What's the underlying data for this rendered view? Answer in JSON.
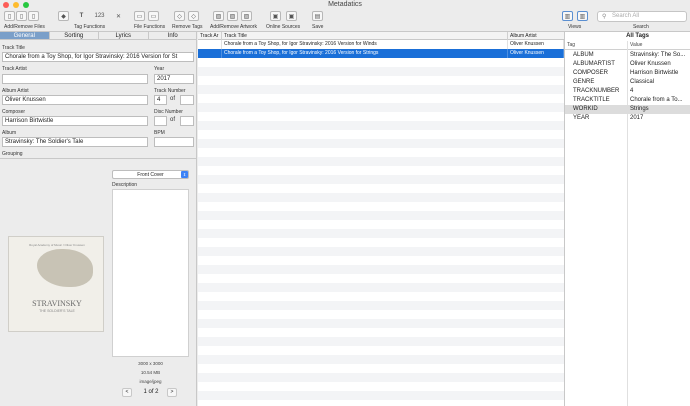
{
  "window": {
    "title": "Metadatics"
  },
  "toolbar": {
    "groups": [
      {
        "label": "Add/Remove Files",
        "icons": [
          "doc-icon",
          "doc-add-icon",
          "doc-remove-icon"
        ]
      },
      {
        "label": "Tag Functions",
        "icons": [
          "tag-icon",
          "text-T-icon",
          "number-123-icon",
          "tools-icon"
        ]
      },
      {
        "label": "File Functions",
        "icons": [
          "file-functions-icon-1",
          "file-functions-icon-2"
        ]
      },
      {
        "label": "Remove Tags",
        "icons": [
          "remove-tags-icon-1",
          "remove-tags-icon-2"
        ]
      },
      {
        "label": "Add/Remove Artwork",
        "icons": [
          "artwork-icon-1",
          "artwork-icon-2",
          "artwork-icon-3"
        ]
      },
      {
        "label": "Online Sources",
        "icons": [
          "online-source-icon-1",
          "online-source-icon-2"
        ]
      },
      {
        "label": "Save",
        "icons": [
          "save-icon"
        ]
      },
      {
        "label": "Views",
        "icons": [
          "view-left-icon",
          "view-right-icon"
        ]
      }
    ],
    "search_label": "Search",
    "search_placeholder": "Search All"
  },
  "left_tabs": [
    "General",
    "Sorting",
    "Lyrics",
    "Info"
  ],
  "fields": {
    "track_title_label": "Track Title",
    "track_title": "Chorale from a Toy Shop, for Igor Stravinsky: 2016 Version for St",
    "track_artist_label": "Track Artist",
    "track_artist": "",
    "year_label": "Year",
    "year": "2017",
    "album_artist_label": "Album Artist",
    "album_artist": "Oliver Knussen",
    "track_number_label": "Track Number",
    "track_number": "4",
    "track_of_label": "of",
    "track_total": "",
    "composer_label": "Composer",
    "composer": "Harrison Birtwistle",
    "disc_number_label": "Disc Number",
    "disc_number": "",
    "disc_of_label": "of",
    "disc_total": "",
    "album_label": "Album",
    "album": "Stravinsky: The Soldier's Tale",
    "bpm_label": "BPM",
    "bpm": "",
    "grouping_label": "Grouping"
  },
  "artwork": {
    "type_select": "Front Cover",
    "description_label": "Description",
    "dimensions": "3000 x 3000",
    "size": "10.54 MB",
    "format": "image/jpeg",
    "page": "1 of 2",
    "prev": "<",
    "next": ">",
    "cover_title": "STRAVINSKY",
    "cover_subtitle": "THE SOLDIER'S TALE",
    "cover_small": "Royal Academy of Music / Oliver Knussen"
  },
  "middle_table": {
    "columns": [
      "Track Ar",
      "Track Title",
      "Album Artist"
    ],
    "rows": [
      {
        "track_artist": "",
        "track_title": "Chorale from a Toy Shop, for Igor Stravinsky: 2016 Version for Winds",
        "album_artist": "Oliver Knussen",
        "selected": false
      },
      {
        "track_artist": "",
        "track_title": "Chorale from a Toy Shop, for Igor Stravinsky: 2016 Version for Strings",
        "album_artist": "Oliver Knussen",
        "selected": true
      }
    ]
  },
  "all_tags": {
    "title": "All Tags",
    "col_tag": "Tag",
    "col_value": "Value",
    "rows": [
      {
        "tag": "ALBUM",
        "value": "Stravinsky: The So..."
      },
      {
        "tag": "ALBUMARTIST",
        "value": "Oliver Knussen"
      },
      {
        "tag": "COMPOSER",
        "value": "Harrison Birtwistle"
      },
      {
        "tag": "GENRE",
        "value": "Classical"
      },
      {
        "tag": "TRACKNUMBER",
        "value": "4"
      },
      {
        "tag": "TRACKTITLE",
        "value": "Chorale from a To..."
      },
      {
        "tag": "WORKID",
        "value": "Strings"
      },
      {
        "tag": "YEAR",
        "value": "2017"
      }
    ]
  },
  "colors": {
    "selection": "#1a6fd8",
    "active_tab": "#7a9fc9",
    "close": "#fd5d57",
    "minimize": "#febc2e",
    "zoom": "#27c840"
  }
}
